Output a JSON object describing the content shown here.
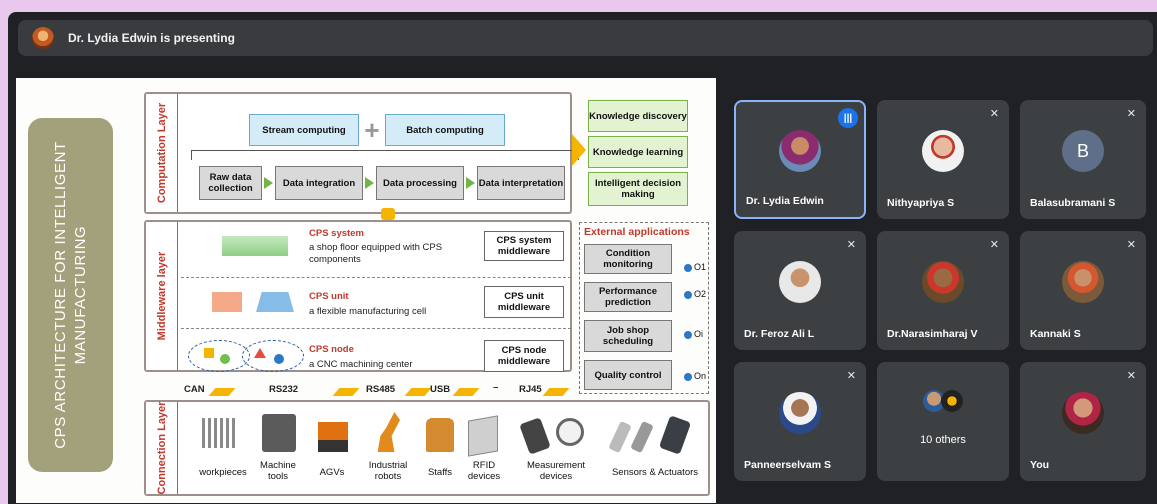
{
  "presenter_bar": {
    "text": "Dr. Lydia Edwin is presenting"
  },
  "slide": {
    "side_title": "CPS ARCHITECTURE FOR INTELLIGENT MANUFACTURING",
    "computation": {
      "label": "Computation Layer",
      "stream": "Stream computing",
      "batch": "Batch computing",
      "plus": "+",
      "steps": [
        "Raw data collection",
        "Data integration",
        "Data processing",
        "Data interpretation"
      ],
      "outputs": [
        "Knowledge discovery",
        "Knowledge learning",
        "Intelligent decision making"
      ]
    },
    "middleware": {
      "label": "Middleware layer",
      "rows": [
        {
          "title": "CPS system",
          "desc": "a shop floor equipped with CPS components",
          "box": "CPS system middleware"
        },
        {
          "title": "CPS unit",
          "desc": "a flexible manufacturing cell",
          "box": "CPS unit middleware"
        },
        {
          "title": "CPS node",
          "desc": "a CNC machining center",
          "box": "CPS node middleware"
        }
      ],
      "external_title": "External applications",
      "external": [
        "Condition monitoring",
        "Performance prediction",
        "Job shop scheduling",
        "Quality control"
      ],
      "outputs": [
        "O1",
        "O2",
        "Oi",
        "On"
      ]
    },
    "protocols": [
      "CAN",
      "RS232",
      "RS485",
      "USB",
      "RJ45"
    ],
    "protocol_dash": "–",
    "connection": {
      "label": "Connection Layer",
      "devices": [
        "workpieces",
        "Machine tools",
        "AGVs",
        "Industrial robots",
        "Staffs",
        "RFID devices",
        "Measurement devices",
        "Sensors & Actuators"
      ]
    }
  },
  "participants": [
    {
      "name": "Dr. Lydia Edwin",
      "status": "speaking"
    },
    {
      "name": "Nithyapriya S",
      "status": "muted"
    },
    {
      "name": "Balasubramani S",
      "status": "muted",
      "initial": "B"
    },
    {
      "name": "Dr. Feroz Ali L",
      "status": "muted"
    },
    {
      "name": "Dr.Narasimharaj V",
      "status": "muted"
    },
    {
      "name": "Kannaki S",
      "status": "muted"
    },
    {
      "name": "Panneerselvam S",
      "status": "muted"
    },
    {
      "name": "10 others",
      "status": "group"
    },
    {
      "name": "You",
      "status": "muted"
    }
  ],
  "colors": {
    "speaking": "#1a73e8",
    "active_border": "#8ab4f8",
    "tile": "#3c4043",
    "window": "#202124",
    "page_bg": "#e9c8ee"
  }
}
